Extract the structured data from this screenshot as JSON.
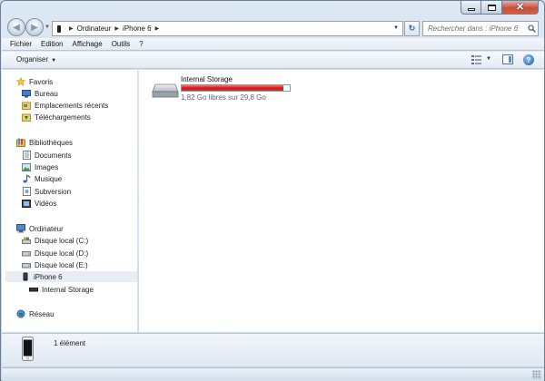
{
  "window": {
    "caption_icons": [
      "minimize-icon",
      "maximize-icon",
      "close-icon"
    ]
  },
  "address_bar": {
    "segments": [
      "Ordinateur",
      "iPhone 6"
    ],
    "device_icon": "phone-icon"
  },
  "search": {
    "placeholder": "Rechercher dans : iPhone 6"
  },
  "menu": {
    "items": [
      "Fichier",
      "Edition",
      "Affichage",
      "Outils",
      "?"
    ]
  },
  "toolbar": {
    "organize_label": "Organiser",
    "help_label": "?"
  },
  "nav_pane": {
    "favorites": {
      "label": "Favoris",
      "icon": "star-icon",
      "items": [
        {
          "label": "Bureau",
          "icon": "desktop-icon"
        },
        {
          "label": "Emplacements récents",
          "icon": "recent-places-icon"
        },
        {
          "label": "Téléchargements",
          "icon": "downloads-icon"
        }
      ]
    },
    "libraries": {
      "label": "Bibliothèques",
      "icon": "libraries-icon",
      "items": [
        {
          "label": "Documents",
          "icon": "documents-icon"
        },
        {
          "label": "Images",
          "icon": "images-icon"
        },
        {
          "label": "Musique",
          "icon": "music-icon"
        },
        {
          "label": "Subversion",
          "icon": "subversion-icon"
        },
        {
          "label": "Vidéos",
          "icon": "videos-icon"
        }
      ]
    },
    "computer": {
      "label": "Ordinateur",
      "icon": "computer-icon",
      "items": [
        {
          "label": "Disque local (C:)",
          "icon": "drive-c-icon"
        },
        {
          "label": "Disque local (D:)",
          "icon": "drive-icon"
        },
        {
          "label": "Disque local (E:)",
          "icon": "drive-icon"
        },
        {
          "label": "iPhone 6",
          "icon": "phone-icon"
        },
        {
          "label": "Internal Storage",
          "icon": "storage-icon"
        }
      ]
    },
    "network": {
      "label": "Réseau",
      "icon": "network-icon"
    }
  },
  "content": {
    "drive": {
      "name": "Internal Storage",
      "free_text": "1,82 Go libres sur 29,8 Go",
      "used_fraction": 0.939,
      "bar_color": "#d41717"
    }
  },
  "details": {
    "count_text": "1 élément"
  }
}
